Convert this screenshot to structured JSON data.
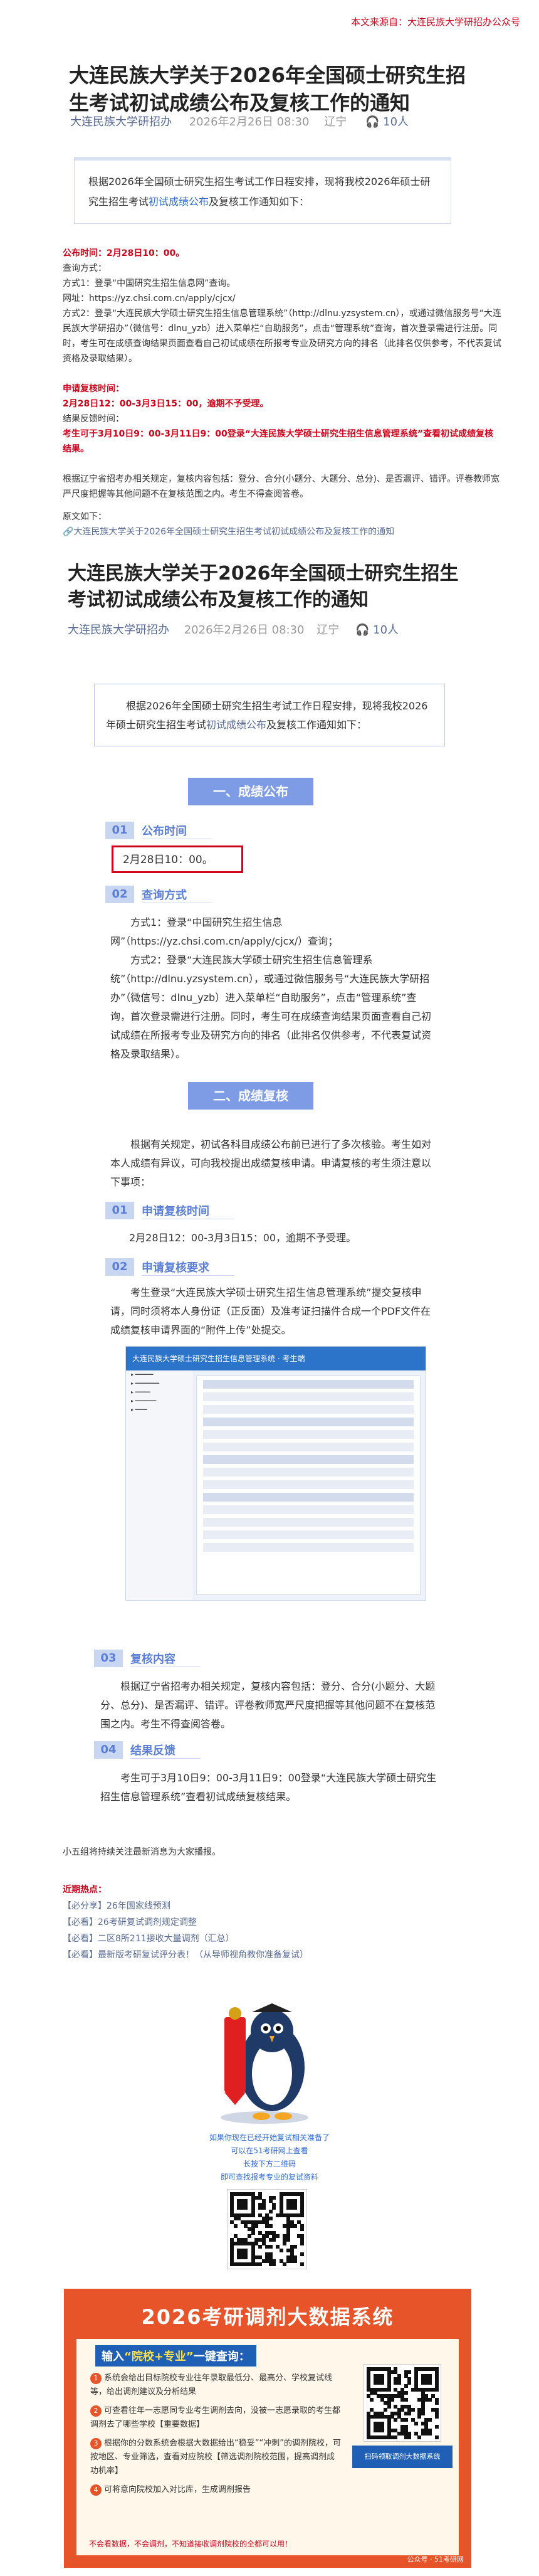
{
  "source_note": "本文来源自：大连民族大学研招办公众号",
  "article": {
    "title": "大连民族大学关于2026年全国硕士研究生招生考试初试成绩公布及复核工作的通知",
    "account": "大连民族大学研招办",
    "date": "2026年2月26日 08:30",
    "location": "辽宁",
    "views": "10人"
  },
  "intro": {
    "text_a": "根据2026年全国硕士研究生招生考试工作日程安排，现将我校2026年硕士研究生招生考试",
    "keyword": "初试成绩公布",
    "text_b": "及复核工作通知如下："
  },
  "summary": {
    "publish_time": "公布时间：2月28日10：00。",
    "query_method": "查询方式：",
    "method1_label": "方式1：登录“中国研究生招生信息网”查询。",
    "method_url_label": "网址：https://yz.chsi.com.cn/apply/cjcx/",
    "method2": "方式2：登录“大连民族大学硕士研究生招生信息管理系统”（http://dlnu.yzsystem.cn），或通过微信服务号“大连民族大学研招办”（微信号：dlnu_yzb）进入菜单栏“自助服务”，点击“管理系统”查询，首次登录需进行注册。同时，考生可在成绩查询结果页面查看自己初试成绩在所报考专业及研究方向的排名（此排名仅供参考，不代表复试资格及录取结果）。",
    "review_time_label": "申请复核时间：",
    "review_time": "2月28日12：00-3月3日15：00，逾期不予受理。",
    "review_result_label": "结果反馈时间：",
    "review_result": "考生可于3月10日9：00-3月11日9：00登录“大连民族大学硕士研究生招生信息管理系统”查看初试成绩复核结果。",
    "review_content": "根据辽宁省招考办相关规定，复核内容包括：登分、合分(小题分、大题分、总分)、是否漏评、错评。评卷教师宽严尺度把握等其他问题不在复核范围之内。考生不得查阅答卷。",
    "original_label": "原文如下：",
    "original_link": "大连民族大学关于2026年全国硕士研究生招生考试初试成绩公布及复核工作的通知"
  },
  "embedded": {
    "title": "大连民族大学关于2026年全国硕士研究生招生考试初试成绩公布及复核工作的通知",
    "account": "大连民族大学研招办",
    "date": "2026年2月26日 08:30",
    "location": "辽宁",
    "views": "10人",
    "intro_a": "根据2026年全国硕士研究生招生考试工作日程安排，现将我校2026年硕士研究生招生考试",
    "intro_kw": "初试成绩公布",
    "intro_b": "及复核工作通知如下：",
    "section1": "一、成绩公布",
    "s1_sub1_num": "01",
    "s1_sub1": "公布时间",
    "s1_time": "2月28日10：00。",
    "s1_sub2_num": "02",
    "s1_sub2": "查询方式",
    "s1_method1": "方式1：登录“中国研究生招生信息网”（https://yz.chsi.com.cn/apply/cjcx/）查询；",
    "s1_method2": "方式2：登录“大连民族大学硕士研究生招生信息管理系统”（http://dlnu.yzsystem.cn），或通过微信服务号“大连民族大学研招办”（微信号：dlnu_yzb）进入菜单栏“自助服务”，点击“管理系统”查询，首次登录需进行注册。同时，考生可在成绩查询结果页面查看自己初试成绩在所报考专业及研究方向的排名（此排名仅供参考，不代表复试资格及录取结果）。",
    "section2": "二、成绩复核",
    "s2_intro": "根据有关规定，初试各科目成绩公布前已进行了多次核验。考生如对本人成绩有异议，可向我校提出成绩复核申请。申请复核的考生须注意以下事项：",
    "s2_sub1_num": "01",
    "s2_sub1": "申请复核时间",
    "s2_time": "2月28日12：00-3月3日15：00，逾期不予受理。",
    "s2_sub2_num": "02",
    "s2_sub2": "申请复核要求",
    "s2_req": "考生登录“大连民族大学硕士研究生招生信息管理系统”提交复核申请，同时须将本人身份证（正反面）及准考证扫描件合成一个PDF文件在成绩复核申请界面的“附件上传”处提交。",
    "shot_title": "大连民族大学硕士研究生招生信息管理系统 · 考生端",
    "s2_sub3_num": "03",
    "s2_sub3": "复核内容",
    "s2_content": "根据辽宁省招考办相关规定，复核内容包括：登分、合分(小题分、大题分、总分)、是否漏评、错评。评卷教师宽严尺度把握等其他问题不在复核范围之内。考生不得查阅答卷。",
    "s2_sub4_num": "04",
    "s2_sub4": "结果反馈",
    "s2_result": "考生可于3月10日9：00-3月11日9：00登录“大连民族大学硕士研究生招生信息管理系统”查看初试成绩复核结果。"
  },
  "footer": {
    "closing": "小五组将持续关注最新消息为大家播报。",
    "recent_label": "近期热点：",
    "links": [
      "【必分享】26年国家线预测",
      "【必看】26考研复试调剂规定调整",
      "【必看】二区8所211接收大量调剂（汇总）",
      "【必看】最新版考研复试评分表！（从导师视角教你准备复试）"
    ],
    "promo_lines": [
      "如果你现在已经开始复试相关准备了",
      "可以在51考研网上查看",
      "长按下方二维码",
      "即可查找报考专业的复试资料"
    ]
  },
  "ad": {
    "headline": "2026考研调剂大数据系统",
    "ask_prefix": "输入",
    "ask_hl": "“院校+专业”",
    "ask_suffix": "一键查询：",
    "items": [
      "系统会给出目标院校专业往年录取最低分、最高分、学校复试线等，给出调剂建议及分析结果",
      "可查看往年一志愿同专业考生调剂去向，没被一志愿录取的考生都调剂去了哪些学校【重要数据】",
      "根据你的分数系统会根据大数据给出“稳妥”“冲刺”的调剂院校，可按地区、专业筛选，查看对应院校【筛选调剂院校范围，提高调剂成功机率】",
      "可将意向院校加入对比库，生成调剂报告"
    ],
    "warn": "不会看数据，不会调剂，不知道接收调剂院校的全都可以用！",
    "qr_caption": "扫码领取调剂大数据系统",
    "watermark": "公众号 · 51考研网"
  },
  "colors": {
    "red": "#d0021b",
    "accent": "#2f6bd8",
    "banner": "#7e9ce6",
    "ad_orange": "#e8542a"
  }
}
